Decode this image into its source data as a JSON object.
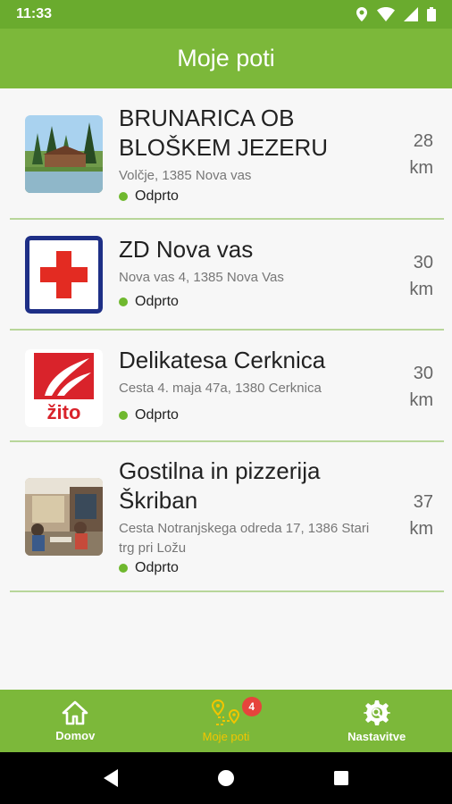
{
  "status_bar": {
    "time": "11:33"
  },
  "app_bar": {
    "title": "Moje poti"
  },
  "items": [
    {
      "name": "BRUNARICA OB BLOŠKEM JEZERU",
      "address": "Volčje, 1385 Nova vas",
      "status": "Odprto",
      "distance_value": "28",
      "distance_unit": "km",
      "thumbnail": "lake-cabin-photo"
    },
    {
      "name": "ZD Nova vas",
      "address": "Nova vas 4, 1385 Nova Vas",
      "status": "Odprto",
      "distance_value": "30",
      "distance_unit": "km",
      "thumbnail": "red-cross-logo"
    },
    {
      "name": "Delikatesa Cerknica",
      "address": "Cesta 4. maja 47a, 1380 Cerknica",
      "status": "Odprto",
      "distance_value": "30",
      "distance_unit": "km",
      "thumbnail": "zito-logo"
    },
    {
      "name": "Gostilna in pizzerija Škriban",
      "address": "Cesta Notranjskega odreda 17, 1386 Stari trg pri Ložu",
      "status": "Odprto",
      "distance_value": "37",
      "distance_unit": "km",
      "thumbnail": "restaurant-photo"
    }
  ],
  "zito_logo_text": "žito",
  "bottom_nav": {
    "items": [
      {
        "label": "Domov",
        "icon": "home-icon",
        "active": false
      },
      {
        "label": "Moje poti",
        "icon": "route-icon",
        "active": true,
        "badge": "4"
      },
      {
        "label": "Nastavitve",
        "icon": "settings-icon",
        "active": false
      }
    ]
  },
  "colors": {
    "app_bar": "#7cb83a",
    "status_bar": "#6aab2e",
    "active_nav": "#f2c500",
    "open_dot": "#6fb82e",
    "badge": "#e6443c",
    "divider": "#b8d69a"
  }
}
